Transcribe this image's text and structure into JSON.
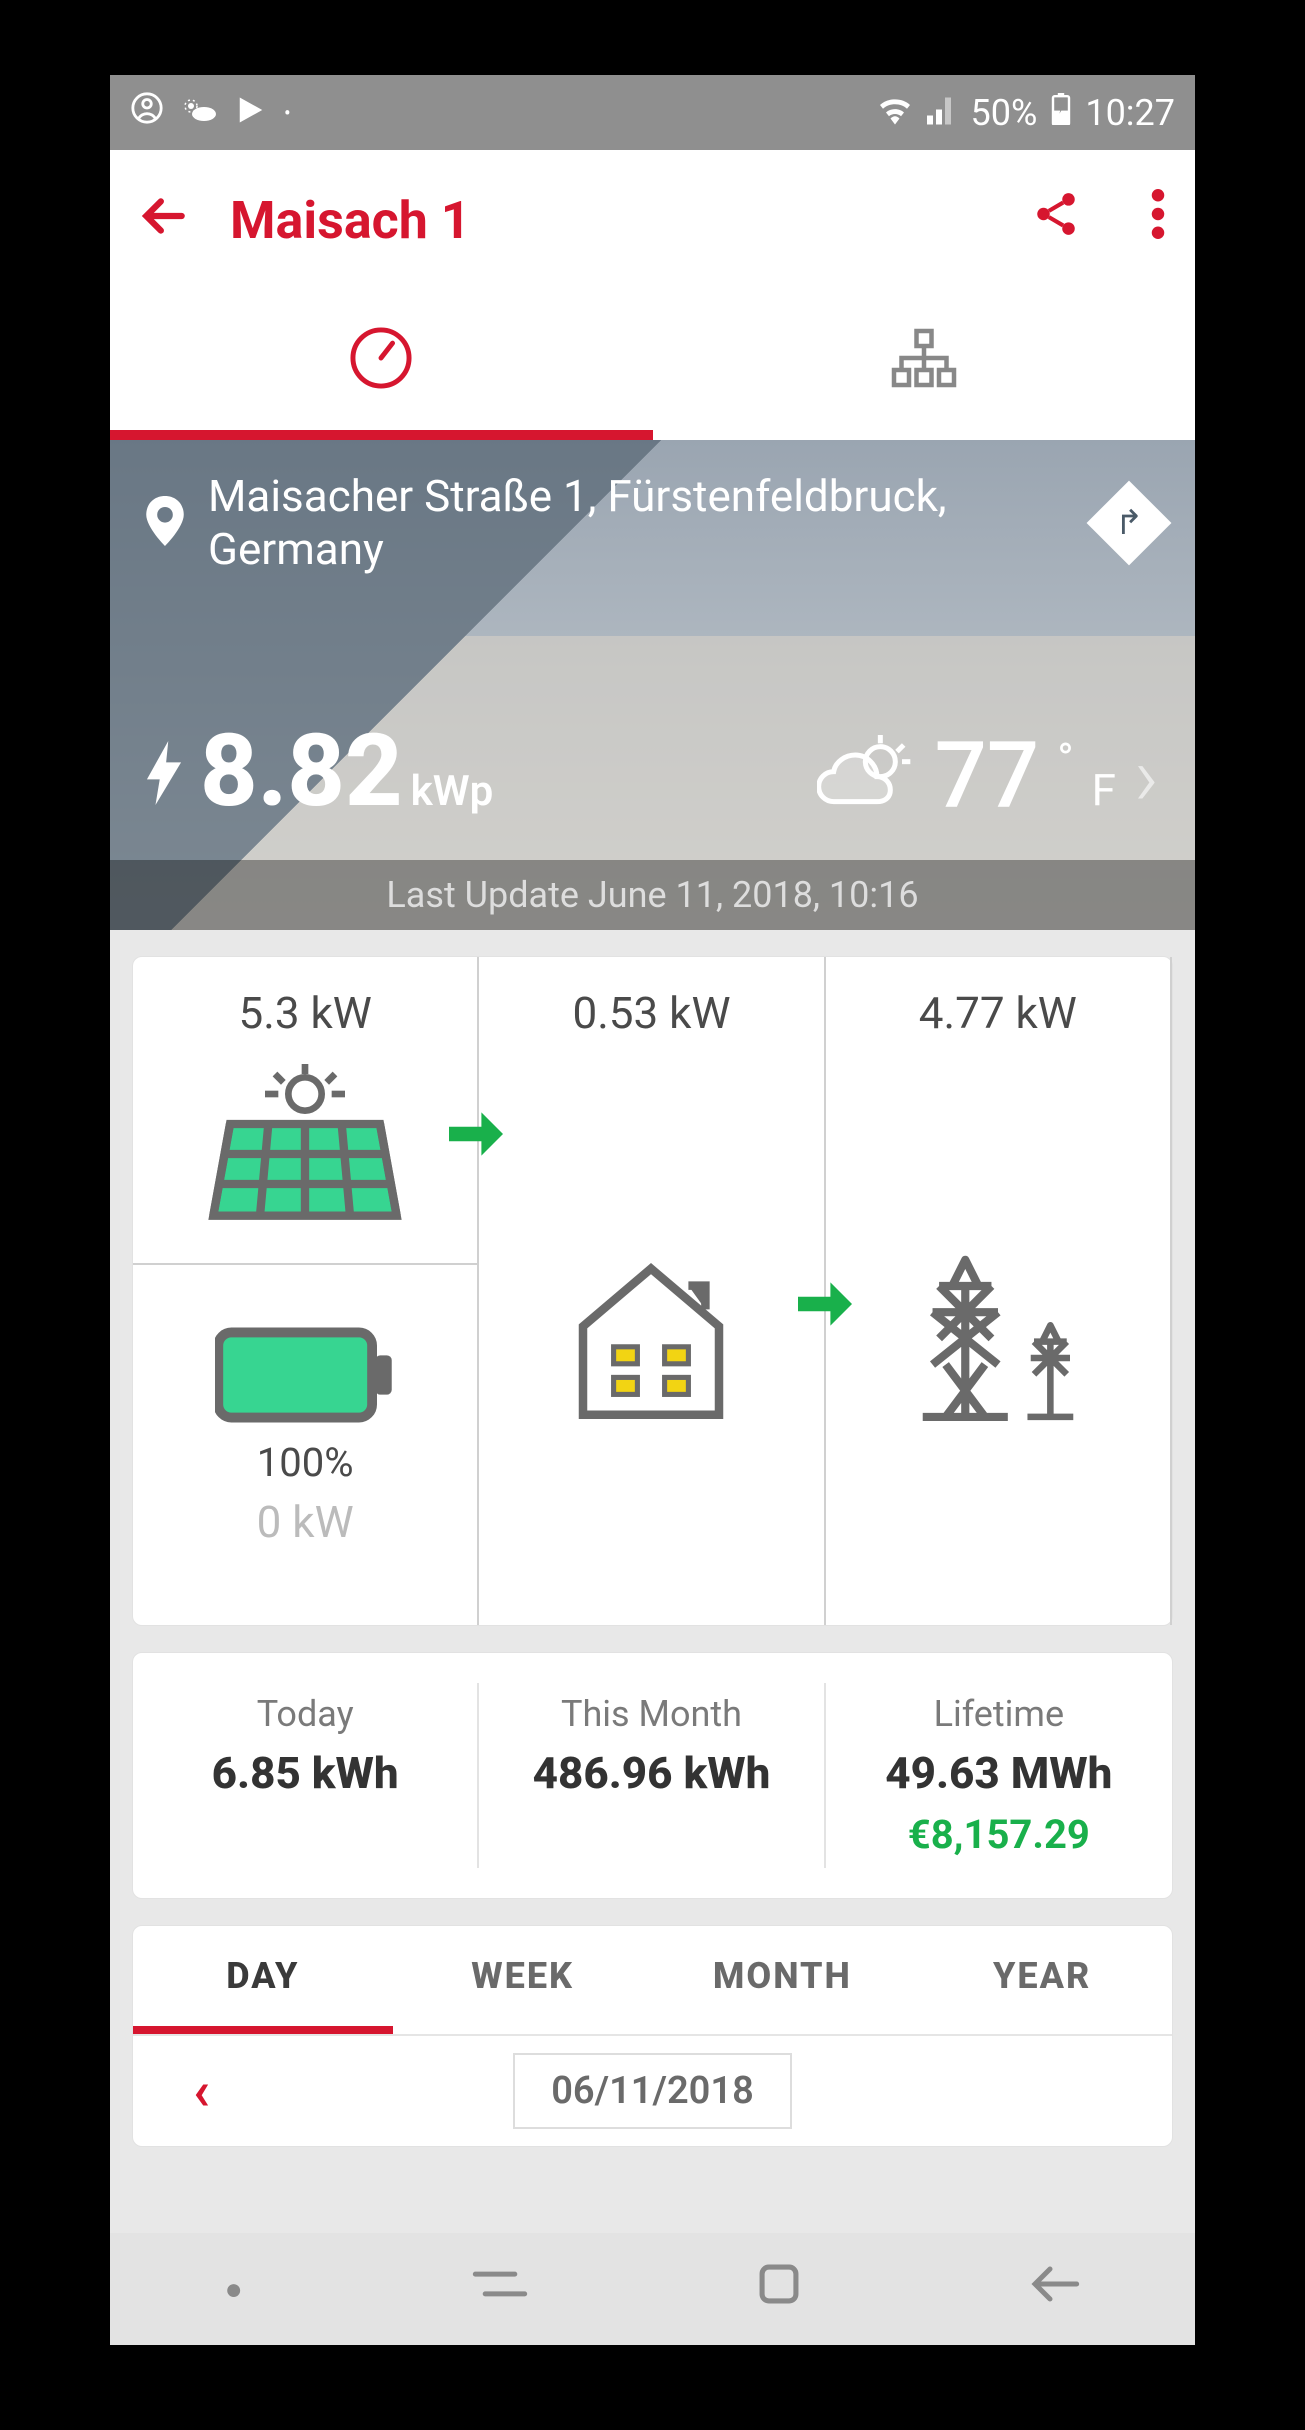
{
  "status": {
    "battery_pct": "50%",
    "time": "10:27"
  },
  "app_bar": {
    "title": "Maisach 1"
  },
  "hero": {
    "address": "Maisacher Straße 1, Fürstenfeldbruck, Germany",
    "kwp_value": "8.82",
    "kwp_unit": "kWp",
    "temp_value": "77",
    "temp_unit": "°",
    "temp_scale": "F",
    "last_update_label": "Last Update June 11, 2018, 10:16"
  },
  "flow": {
    "solar": "5.3 kW",
    "home": "0.53 kW",
    "grid": "4.77 kW",
    "battery_pct": "100%",
    "battery_kw": "0 kW"
  },
  "stats": {
    "today_label": "Today",
    "today_val": "6.85 kWh",
    "month_label": "This Month",
    "month_val": "486.96 kWh",
    "lifetime_label": "Lifetime",
    "lifetime_val": "49.63 MWh",
    "lifetime_money": "€8,157.29"
  },
  "period": {
    "tabs": {
      "day": "DAY",
      "week": "WEEK",
      "month": "MONTH",
      "year": "YEAR"
    },
    "date": "06/11/2018"
  }
}
